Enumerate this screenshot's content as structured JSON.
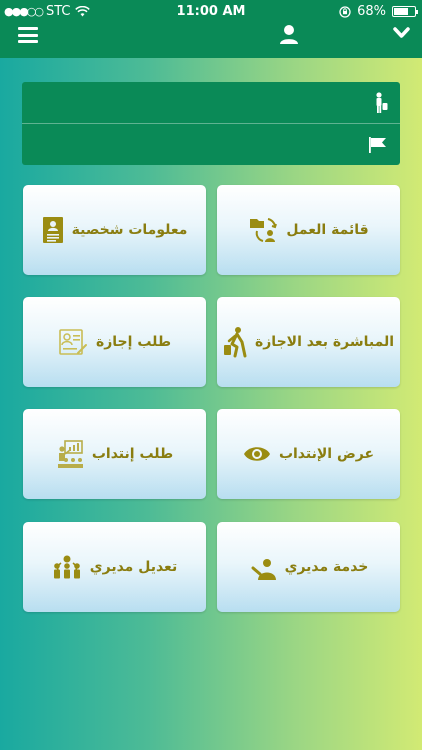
{
  "status": {
    "carrier": "STC",
    "signal_dots": "●●●○○",
    "time": "11:00 AM",
    "battery_percent": "68%",
    "battery_level": 0.68
  },
  "header": {
    "menu_icon": "hamburger-icon",
    "user_icon": "user-icon",
    "dropdown_icon": "chevron-down-icon"
  },
  "form": {
    "field1": {
      "value": "",
      "placeholder": "",
      "icon": "person-luggage-icon"
    },
    "field2": {
      "value": "",
      "placeholder": "",
      "icon": "flag-icon"
    }
  },
  "tiles": [
    {
      "label": "قائمة العمل",
      "icon": "worklist-icon"
    },
    {
      "label": "معلومات شخصية",
      "icon": "profile-document-icon"
    },
    {
      "label": "المباشرة بعد الاجازة",
      "icon": "walking-luggage-icon"
    },
    {
      "label": "طلب إجازة",
      "icon": "leave-form-icon"
    },
    {
      "label": "عرض الإنتداب",
      "icon": "eye-icon"
    },
    {
      "label": "طلب إنتداب",
      "icon": "presentation-icon"
    },
    {
      "label": "خدمة مديري",
      "icon": "question-person-icon"
    },
    {
      "label": "تعديل مديري",
      "icon": "group-icon"
    }
  ],
  "colors": {
    "header": "#0a8a57",
    "tile_text": "#8a7d10",
    "icon": "#9a8c12"
  }
}
